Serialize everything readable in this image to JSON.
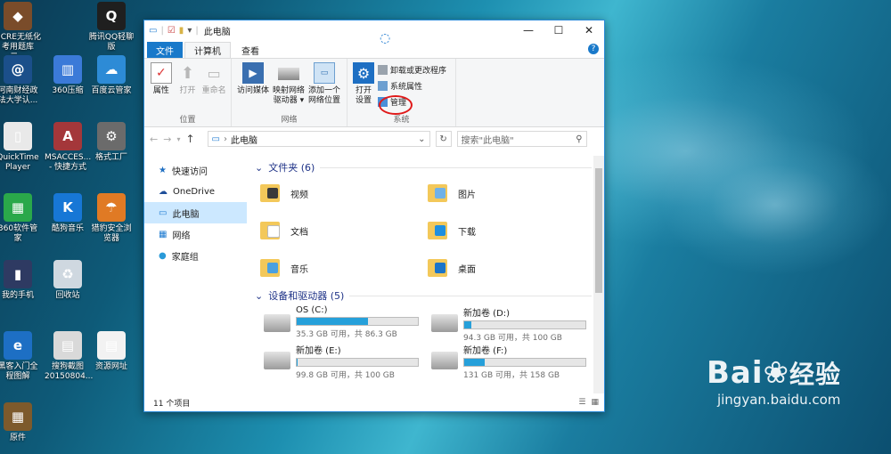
{
  "desktop": {
    "icons": [
      {
        "label": "NCRE无纸化\n考用题库二...",
        "glyph": "◆",
        "color": "#7a4c2a"
      },
      {
        "label": "腾讯QQ轻聊\n版",
        "glyph": "Q",
        "color": "#1f1f1f"
      },
      {
        "label": "河南财经政\n法大学认...",
        "glyph": "@",
        "color": "#1b4f8a"
      },
      {
        "label": "360压缩",
        "glyph": "▥",
        "color": "#3b7ad8"
      },
      {
        "label": "百度云管家",
        "glyph": "☁",
        "color": "#2d8bd6"
      },
      {
        "label": "QuickTime\nPlayer",
        "glyph": "▯",
        "color": "#e9e9e9"
      },
      {
        "label": "MSACCES...\n- 快捷方式",
        "glyph": "A",
        "color": "#a4373a"
      },
      {
        "label": "格式工厂",
        "glyph": "⚙",
        "color": "#6b6b6b"
      },
      {
        "label": "360软件管家",
        "glyph": "▦",
        "color": "#2aa84a"
      },
      {
        "label": "酷狗音乐",
        "glyph": "K",
        "color": "#1777d6"
      },
      {
        "label": "猎豹安全浏\n览器",
        "glyph": "☂",
        "color": "#e07a24"
      },
      {
        "label": "我的手机",
        "glyph": "▮",
        "color": "#2e3a62"
      },
      {
        "label": "回收站",
        "glyph": "♻",
        "color": "#cfd8e0"
      },
      {
        "label": "黑客入门全\n程图解",
        "glyph": "e",
        "color": "#1d6fc4"
      },
      {
        "label": "搜狗截图\n20150804...",
        "glyph": "▤",
        "color": "#d9d9d9"
      },
      {
        "label": "资源网址",
        "glyph": "▤",
        "color": "#f2f2f2"
      },
      {
        "label": "原件",
        "glyph": "▦",
        "color": "#7d5a2c"
      }
    ]
  },
  "window": {
    "title": "此电脑",
    "quick_access_sep": "|",
    "controls": {
      "minimize": "—",
      "maximize": "☐",
      "close": "✕"
    },
    "tabs": [
      "文件",
      "计算机",
      "查看"
    ],
    "help": "?",
    "ribbon": {
      "location": {
        "group_label": "位置",
        "buttons": [
          "属性",
          "打开",
          "重命名"
        ]
      },
      "network": {
        "group_label": "网络",
        "buttons": [
          "访问媒体",
          "映射网络\n驱动器 ▾",
          "添加一个\n网络位置"
        ]
      },
      "system": {
        "group_label": "系统",
        "big": "打开\n设置",
        "small": [
          "卸载或更改程序",
          "系统属性",
          "管理"
        ]
      }
    },
    "address": {
      "path": "此电脑",
      "search_placeholder": "搜索\"此电脑\""
    },
    "nav_pane": [
      {
        "label": "快速访问",
        "icon": "★",
        "color": "#1f6fc2"
      },
      {
        "label": "OneDrive",
        "icon": "☁",
        "color": "#1f4f9a"
      },
      {
        "label": "此电脑",
        "icon": "▭",
        "color": "#1d7ad0",
        "selected": true
      },
      {
        "label": "网络",
        "icon": "▦",
        "color": "#1d7ad0"
      },
      {
        "label": "家庭组",
        "icon": "●",
        "color": "#2a9ad8"
      }
    ],
    "folders_header": "文件夹 (6)",
    "folders": [
      "视频",
      "图片",
      "文档",
      "下载",
      "音乐",
      "桌面"
    ],
    "drives_header": "设备和驱动器 (5)",
    "drives": [
      {
        "name": "OS (C:)",
        "free": "35.3 GB 可用，共 86.3 GB",
        "used_fraction": 0.59
      },
      {
        "name": "新加卷 (D:)",
        "free": "94.3 GB 可用，共 100 GB",
        "used_fraction": 0.06
      },
      {
        "name": "新加卷 (E:)",
        "free": "99.8 GB 可用，共 100 GB",
        "used_fraction": 0.002
      },
      {
        "name": "新加卷 (F:)",
        "free": "131 GB 可用，共 158 GB",
        "used_fraction": 0.17
      }
    ],
    "status": "11 个项目"
  },
  "watermark": {
    "brand": "Bai",
    "brand2": "经验",
    "url": "jingyan.baidu.com"
  }
}
